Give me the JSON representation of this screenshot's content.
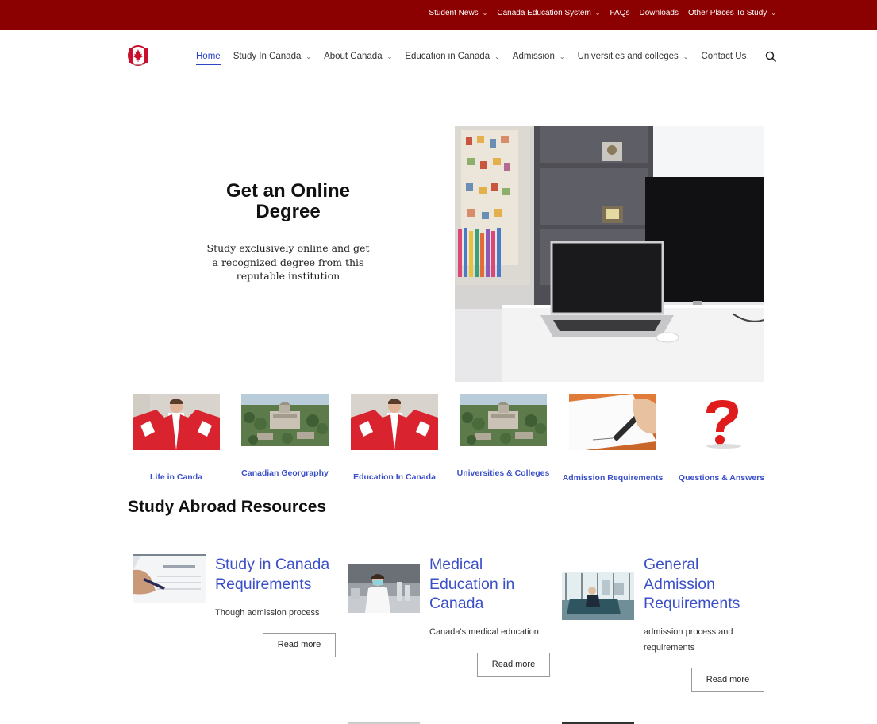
{
  "topbar": {
    "items": [
      {
        "label": "Student News",
        "dropdown": true
      },
      {
        "label": "Canada Education System",
        "dropdown": true
      },
      {
        "label": "FAQs",
        "dropdown": false
      },
      {
        "label": "Downloads",
        "dropdown": false
      },
      {
        "label": "Other Places To Study",
        "dropdown": true
      }
    ]
  },
  "header": {
    "logo_icon": "canada-maple-leaf-logo",
    "nav": [
      {
        "label": "Home",
        "active": true
      },
      {
        "label": "Study In Canada",
        "dropdown": true
      },
      {
        "label": "About Canada",
        "dropdown": true
      },
      {
        "label": "Education in Canada",
        "dropdown": true
      },
      {
        "label": "Admission",
        "dropdown": true
      },
      {
        "label": "Universities and colleges",
        "dropdown": true
      },
      {
        "label": "Contact Us"
      }
    ],
    "search_icon": "search-icon"
  },
  "hero": {
    "title": "Get an Online Degree",
    "text": "Study exclusively online and get a recognized degree from this reputable institution",
    "image": "laptop-on-desk-photo"
  },
  "categories": [
    {
      "label": "Life in Canda",
      "image": "canadian-flag-person-photo"
    },
    {
      "label": "Canadian Georgraphy",
      "image": "campus-aerial-photo"
    },
    {
      "label": "Education In Canada",
      "image": "canadian-flag-person-photo"
    },
    {
      "label": "Universities & Colleges",
      "image": "campus-aerial-photo"
    },
    {
      "label": "Admission Requirements",
      "image": "pen-signing-paper-photo"
    },
    {
      "label": "Questions & Answers",
      "image": "red-question-mark"
    }
  ],
  "resources": {
    "title": "Study Abroad Resources",
    "posts": [
      {
        "title": "Study in Canada Requirements",
        "excerpt": "Though admission process",
        "button": "Read more",
        "image": "visa-application-photo"
      },
      {
        "title": "Medical Education in Canada",
        "excerpt": "Canada's medical education",
        "button": "Read more",
        "image": "medical-lab-photo"
      },
      {
        "title": "General Admission Requirements",
        "excerpt": "admission process and requirements",
        "button": "Read more",
        "image": "student-lounge-photo"
      }
    ]
  },
  "colors": {
    "topbar_bg": "#8b0000",
    "link_blue": "#3b50c8",
    "active_nav": "#2b46c4"
  }
}
